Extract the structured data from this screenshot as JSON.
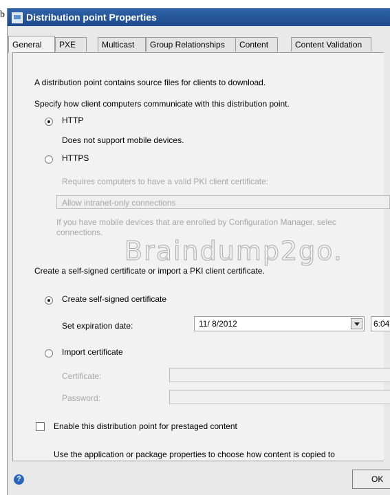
{
  "stray_char": "b",
  "window": {
    "title": "Distribution point Properties"
  },
  "tabs": [
    "General",
    "PXE",
    "Multicast",
    "Group Relationships",
    "Content",
    "Content Validation"
  ],
  "general": {
    "intro": "A distribution point contains source files for clients to download.",
    "comm_label": "Specify how client computers communicate with this distribution point.",
    "http_label": "HTTP",
    "http_note": "Does not support mobile devices.",
    "https_label": "HTTPS",
    "https_requires": "Requires computers to have a valid PKI client certificate:",
    "https_option": "Allow intranet-only connections",
    "https_mobile_note_1": "If you have mobile devices that are enrolled by Configuration Manager, selec",
    "https_mobile_note_2": "connections.",
    "cert_label": "Create a self-signed certificate or import a PKI client certificate.",
    "self_signed_label": "Create self-signed certificate",
    "expiration_label": "Set expiration date:",
    "expiration_date": "11/ 8/2012",
    "expiration_time": "6:04",
    "import_label": "Import certificate",
    "certificate_label": "Certificate:",
    "password_label": "Password:",
    "prestaged_label": "Enable this distribution point for prestaged content",
    "prestaged_note": "Use the application or package properties to choose how content is copied to"
  },
  "watermark": "Braindump2go.",
  "footer": {
    "ok_label": "OK"
  },
  "state": {
    "selected_tab": "General",
    "protocol": "HTTP",
    "certificate_mode": "Create self-signed certificate",
    "prestaged_enabled": false
  }
}
